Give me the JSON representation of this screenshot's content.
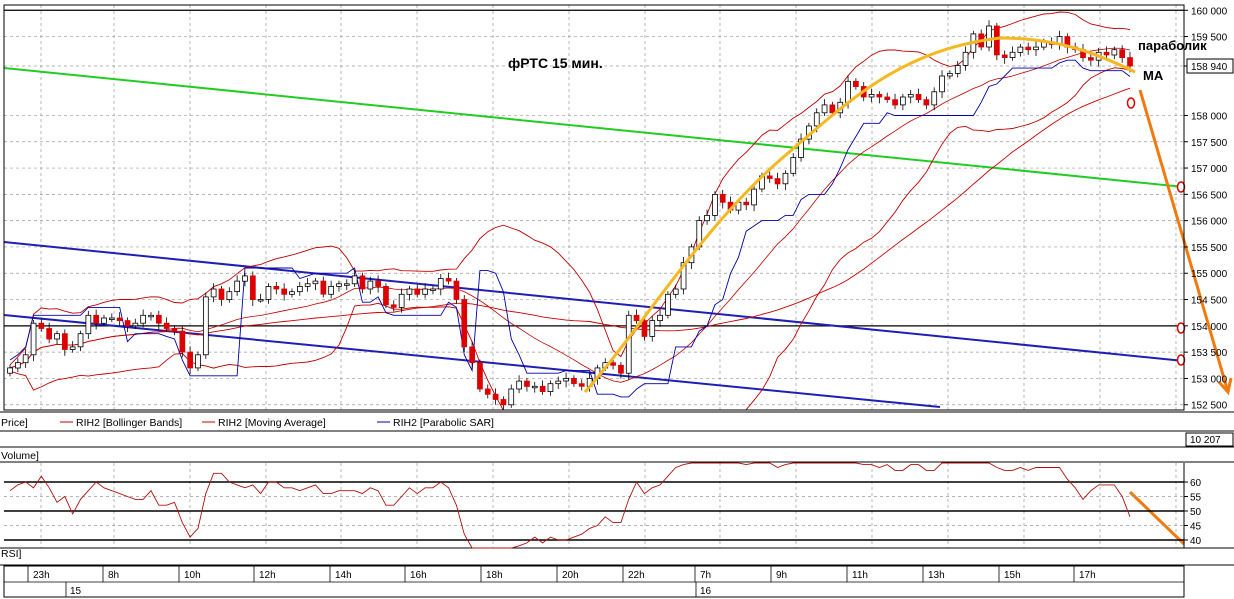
{
  "chart_data": {
    "type": "candlestick",
    "title": "фРТС   15 мин.",
    "annotations": {
      "parabolic": "параболик",
      "ma": "МА"
    },
    "price_axis": {
      "ticks": [
        "160 000",
        "159 500",
        "158 940",
        "158 000",
        "157 500",
        "157 000",
        "156 500",
        "156 000",
        "155 500",
        "155 000",
        "154 500",
        "154 000",
        "153 500",
        "153 000",
        "152 500"
      ],
      "values": [
        160000,
        159500,
        158940,
        158000,
        157500,
        157000,
        156500,
        156000,
        155500,
        155000,
        154500,
        154000,
        153500,
        153000,
        152500
      ],
      "current_price": "158 940",
      "ylim": [
        152400,
        160100
      ]
    },
    "legend": {
      "price": "Price]",
      "bollinger": "RIH2 [Bollinger Bands]",
      "ma": "RIH2 [Moving Average]",
      "sar": "RIH2 [Parabolic SAR]"
    },
    "volume": {
      "label": "Volume]",
      "value": "10 207"
    },
    "rsi": {
      "label": "RSI]",
      "ticks": [
        "60",
        "55",
        "50",
        "45",
        "40"
      ],
      "values": [
        60,
        55,
        50,
        45,
        40
      ]
    },
    "time_axis": {
      "hours": [
        "23h",
        "8h",
        "10h",
        "12h",
        "14h",
        "16h",
        "18h",
        "20h",
        "22h",
        "7h",
        "9h",
        "11h",
        "13h",
        "15h",
        "17h"
      ],
      "days": [
        "15",
        "16"
      ]
    },
    "series": [
      {
        "name": "RIH2",
        "close": [
          153200,
          153300,
          153450,
          154050,
          153950,
          153750,
          153850,
          153550,
          153600,
          153850,
          154200,
          154050,
          154150,
          154150,
          154100,
          154000,
          154050,
          154200,
          154200,
          154050,
          153950,
          153900,
          153500,
          153200,
          153450,
          154550,
          154700,
          154500,
          154650,
          154850,
          154950,
          154500,
          154500,
          154750,
          154700,
          154600,
          154650,
          154750,
          154800,
          154850,
          154600,
          154750,
          154800,
          154800,
          154950,
          154700,
          154850,
          154750,
          154400,
          154350,
          154600,
          154700,
          154600,
          154700,
          154700,
          154900,
          154850,
          154500,
          153600,
          153300,
          152800,
          152700,
          152600,
          152500,
          152800,
          152950,
          152850,
          152850,
          152750,
          152900,
          152950,
          153000,
          152900,
          152850,
          153000,
          153200,
          153300,
          153250,
          153100,
          154200,
          154100,
          153800,
          154100,
          154200,
          154600,
          154700,
          155200,
          155500,
          156000,
          156100,
          156500,
          156350,
          156200,
          156350,
          156300,
          156600,
          156850,
          156800,
          156700,
          156900,
          157200,
          157550,
          157800,
          158050,
          158200,
          158050,
          158250,
          158650,
          158550,
          158350,
          158400,
          158350,
          158300,
          158200,
          158350,
          158400,
          158300,
          158200,
          158450,
          158750,
          158800,
          158950,
          159200,
          159550,
          159300,
          159700,
          159150,
          159100,
          159200,
          159300,
          159250,
          159300,
          159400,
          159350,
          159500,
          159300,
          159250,
          159100,
          159050,
          159200,
          159150,
          159250,
          159100,
          158940
        ]
      }
    ],
    "rsi_values": [
      57,
      59,
      60,
      58,
      62,
      58,
      53,
      55,
      49,
      54,
      57,
      60,
      58,
      57,
      56,
      55,
      54,
      54,
      57,
      52,
      52,
      53,
      46,
      41,
      44,
      56,
      63,
      63,
      60,
      59,
      58,
      59,
      56,
      60,
      60,
      58,
      58,
      57,
      58,
      59,
      56,
      56,
      57,
      57,
      57,
      56,
      58,
      57,
      52,
      52,
      55,
      58,
      56,
      58,
      58,
      60,
      58,
      52,
      42,
      35,
      31,
      30,
      32,
      30,
      37,
      38,
      39,
      41,
      39,
      41,
      40,
      40,
      41,
      42,
      44,
      45,
      48,
      46,
      46,
      54,
      60,
      56,
      58,
      59,
      62,
      65,
      66,
      69,
      71,
      70,
      73,
      70,
      67,
      68,
      66,
      68,
      70,
      67,
      65,
      66,
      67,
      70,
      71,
      71,
      71,
      69,
      69,
      71,
      68,
      66,
      66,
      65,
      66,
      64,
      64,
      66,
      66,
      64,
      64,
      69,
      69,
      70,
      71,
      74,
      67,
      74,
      65,
      64,
      64,
      65,
      64,
      65,
      65,
      65,
      65,
      61,
      58,
      54,
      57,
      59,
      59,
      59,
      55,
      48
    ],
    "colors": {
      "bull": "#ffffff",
      "bear": "#dd0000",
      "bollinger": "#c00000",
      "ma": "#cc0000",
      "sar": "#0000aa",
      "trend_blue": "#1f1fb4",
      "trend_green": "#22cc22",
      "arc": "#f5b820",
      "arrow": "#f07a10",
      "grid": "#9a9a9a"
    }
  }
}
